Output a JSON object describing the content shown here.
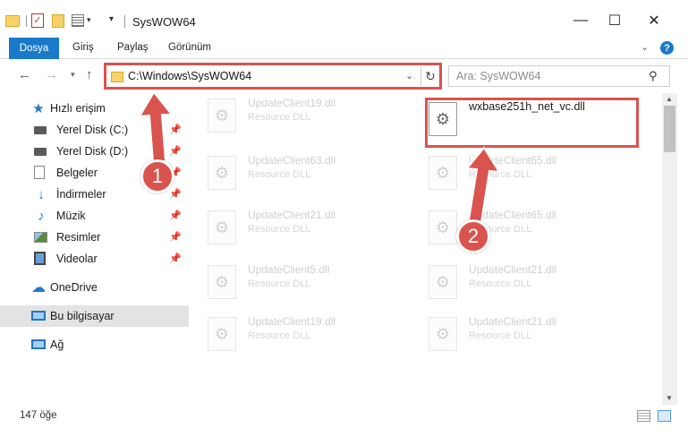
{
  "window": {
    "title": "SysWOW64",
    "minimize": "—",
    "maximize": "☐",
    "close": "✕"
  },
  "ribbon": {
    "file_tab": "Dosya",
    "tabs": [
      "Giriş",
      "Paylaş",
      "Görünüm"
    ],
    "help": "?"
  },
  "navigation": {
    "address": "C:\\Windows\\SysWOW64",
    "search_placeholder": "Ara: SysWOW64"
  },
  "sidebar": {
    "items": [
      {
        "label": "Hızlı erişim",
        "icon": "star-icon"
      },
      {
        "label": "Yerel Disk (C:)",
        "icon": "drive-icon",
        "pinned": true
      },
      {
        "label": "Yerel Disk (D:)",
        "icon": "drive-icon",
        "pinned": true
      },
      {
        "label": "Belgeler",
        "icon": "documents-icon",
        "pinned": true
      },
      {
        "label": "İndirmeler",
        "icon": "downloads-icon",
        "pinned": true
      },
      {
        "label": "Müzik",
        "icon": "music-icon",
        "pinned": true
      },
      {
        "label": "Resimler",
        "icon": "pictures-icon",
        "pinned": true
      },
      {
        "label": "Videolar",
        "icon": "videos-icon",
        "pinned": true
      },
      {
        "label": "OneDrive",
        "icon": "cloud-icon"
      },
      {
        "label": "Bu bilgisayar",
        "icon": "computer-icon",
        "selected": true
      },
      {
        "label": "Ağ",
        "icon": "network-icon"
      }
    ]
  },
  "files": [
    {
      "name": "UpdateClient19.dll",
      "type": "Resource DLL"
    },
    {
      "name": "wxbase251h_net_vc.dll",
      "type": "",
      "highlighted": true
    },
    {
      "name": "UpdateClient63.dll",
      "type": "Resource DLL"
    },
    {
      "name": "UpdateClient65.dll",
      "type": "Resource DLL"
    },
    {
      "name": "UpdateClient21.dll",
      "type": "Resource DLL"
    },
    {
      "name": "UpdateClient65.dll",
      "type": "Resource DLL"
    },
    {
      "name": "UpdateClient5.dll",
      "type": "Resource DLL"
    },
    {
      "name": "UpdateClient21.dll",
      "type": "Resource DLL"
    },
    {
      "name": "UpdateClient19.dll",
      "type": "Resource DLL"
    },
    {
      "name": "UpdateClient21.dll",
      "type": "Resource DLL"
    }
  ],
  "status": {
    "item_count": "147 öğe"
  },
  "annotations": {
    "marker1": "1",
    "marker2": "2",
    "color": "#d9534f"
  }
}
